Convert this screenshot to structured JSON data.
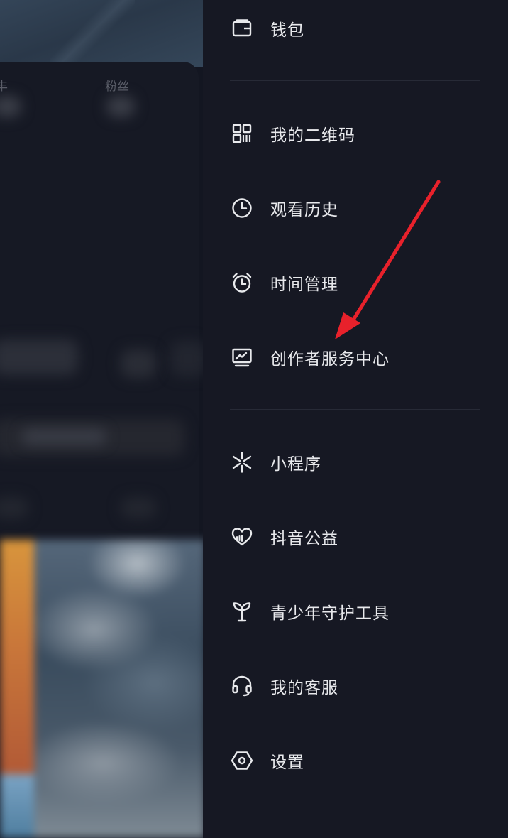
{
  "profile_background": {
    "stats": {
      "left_label_fragment": "丰",
      "fans_label": "粉丝"
    }
  },
  "drawer": {
    "menu_items": [
      {
        "id": "wallet",
        "label": "钱包",
        "icon": "wallet-icon"
      },
      {
        "id": "qrcode",
        "label": "我的二维码",
        "icon": "qr-code-icon"
      },
      {
        "id": "history",
        "label": "观看历史",
        "icon": "clock-icon"
      },
      {
        "id": "time",
        "label": "时间管理",
        "icon": "alarm-clock-icon"
      },
      {
        "id": "creator",
        "label": "创作者服务中心",
        "icon": "monitor-chart-icon"
      },
      {
        "id": "miniapp",
        "label": "小程序",
        "icon": "asterisk-icon"
      },
      {
        "id": "charity",
        "label": "抖音公益",
        "icon": "heart-icon"
      },
      {
        "id": "youth",
        "label": "青少年守护工具",
        "icon": "sprout-icon"
      },
      {
        "id": "service",
        "label": "我的客服",
        "icon": "headset-icon"
      },
      {
        "id": "settings",
        "label": "设置",
        "icon": "hexagon-settings-icon"
      }
    ]
  },
  "annotation": {
    "arrow_color": "#e8212b"
  },
  "colors": {
    "drawer_bg": "#161823",
    "text": "#e8e9ec",
    "divider": "#272a36"
  }
}
